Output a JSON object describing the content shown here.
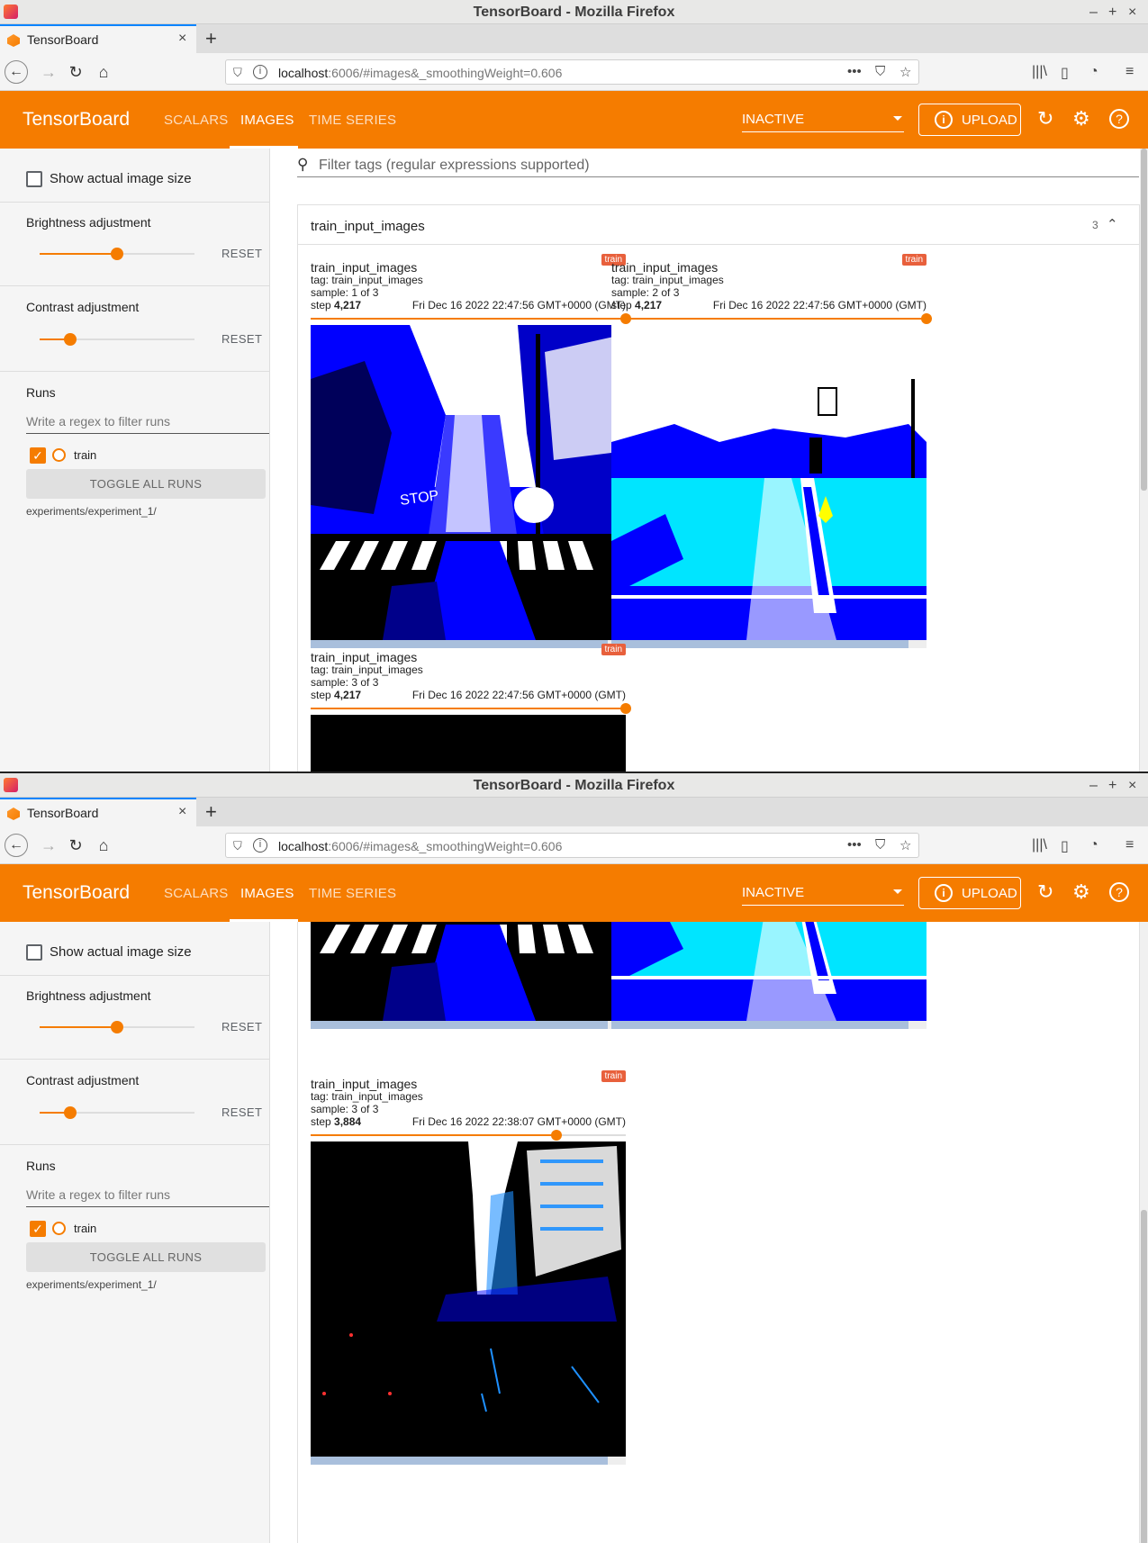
{
  "window": {
    "title": "TensorBoard - Mozilla Firefox",
    "controls": [
      "–",
      "+",
      "×"
    ]
  },
  "browser": {
    "tab_title": "TensorBoard",
    "tab_close": "×",
    "new_tab": "+",
    "url_host": "localhost",
    "url_rest": ":6006/#images&_smoothingWeight=0.606",
    "page_actions": [
      "•••",
      "⛉",
      "☆"
    ],
    "toolbar_icons": [
      "|||\\",
      "▯",
      "◔",
      "≡"
    ]
  },
  "app": {
    "brand": "TensorBoard",
    "nav_tabs": [
      "SCALARS",
      "IMAGES",
      "TIME SERIES"
    ],
    "active_tab": "IMAGES",
    "plugin_selector": "INACTIVE",
    "upload_label": "UPLOAD",
    "accent_color": "#f57c00"
  },
  "sidebar": {
    "show_actual_size": "Show actual image size",
    "brightness": {
      "label": "Brightness adjustment",
      "value": 0.5,
      "reset": "RESET"
    },
    "contrast": {
      "label": "Contrast adjustment",
      "value": 0.2,
      "reset": "RESET"
    },
    "runs_label": "Runs",
    "runs_filter_placeholder": "Write a regex to filter runs",
    "run_name": "train",
    "run_color": "#f57c00",
    "toggle_all": "TOGGLE ALL RUNS",
    "experiment_dir": "experiments/experiment_1/"
  },
  "main": {
    "filter_placeholder": "Filter tags (regular expressions supported)",
    "group_name": "train_input_images",
    "group_count": "3"
  },
  "top_cards": [
    {
      "title": "train_input_images",
      "tag": "tag: train_input_images",
      "sample": "sample: 1 of 3",
      "step_label": "step",
      "step_value": "4,217",
      "wall_time": "Fri Dec 16 2022 22:47:56 GMT+0000 (GMT)",
      "run_badge": "train",
      "step_fraction": 1.0
    },
    {
      "title": "train_input_images",
      "tag": "tag: train_input_images",
      "sample": "sample: 2 of 3",
      "step_label": "step",
      "step_value": "4,217",
      "wall_time": "Fri Dec 16 2022 22:47:56 GMT+0000 (GMT)",
      "run_badge": "train",
      "step_fraction": 1.0
    },
    {
      "title": "train_input_images",
      "tag": "tag: train_input_images",
      "sample": "sample: 3 of 3",
      "step_label": "step",
      "step_value": "4,217",
      "wall_time": "Fri Dec 16 2022 22:47:56 GMT+0000 (GMT)",
      "run_badge": "train",
      "step_fraction": 1.0
    }
  ],
  "bottom_card": {
    "title": "train_input_images",
    "tag": "tag: train_input_images",
    "sample": "sample: 3 of 3",
    "step_label": "step",
    "step_value": "3,884",
    "wall_time": "Fri Dec 16 2022 22:38:07 GMT+0000 (GMT)",
    "run_badge": "train",
    "step_fraction": 0.78
  }
}
